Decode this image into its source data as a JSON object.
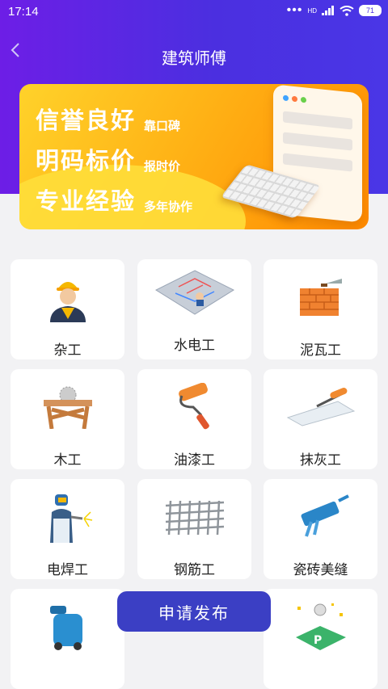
{
  "status_bar": {
    "time": "17:14",
    "network": "HD",
    "battery": "71"
  },
  "nav": {
    "title": "建筑师傅"
  },
  "banner": {
    "rows": [
      {
        "big": "信誉良好",
        "small": "靠口碑"
      },
      {
        "big": "明码标价",
        "small": "报时价"
      },
      {
        "big": "专业经验",
        "small": "多年协作"
      }
    ]
  },
  "categories": [
    {
      "label": "杂工",
      "icon": "worker-icon"
    },
    {
      "label": "水电工",
      "icon": "plumbing-plan-icon"
    },
    {
      "label": "泥瓦工",
      "icon": "brick-wall-icon"
    },
    {
      "label": "木工",
      "icon": "saw-table-icon"
    },
    {
      "label": "油漆工",
      "icon": "paint-roller-icon"
    },
    {
      "label": "抹灰工",
      "icon": "plaster-trowel-icon"
    },
    {
      "label": "电焊工",
      "icon": "welder-icon"
    },
    {
      "label": "钢筋工",
      "icon": "rebar-mesh-icon"
    },
    {
      "label": "瓷砖美缝",
      "icon": "caulk-gun-icon"
    },
    {
      "label": "",
      "icon": "floor-scrubber-icon"
    },
    {
      "label": "",
      "icon": "parking-sign-icon"
    }
  ],
  "publish_button": {
    "label": "申请发布"
  },
  "colors": {
    "header": "#5a25e4",
    "banner": "#ffb316",
    "button": "#3b3fc4"
  }
}
